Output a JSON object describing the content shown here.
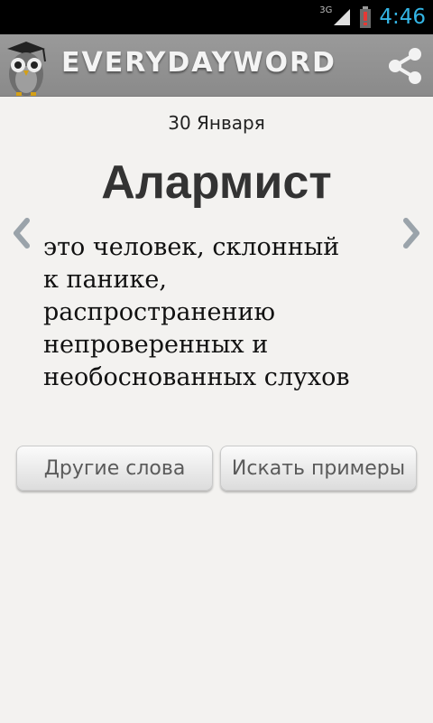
{
  "status_bar": {
    "network": "3G",
    "time": "4:46"
  },
  "app_bar": {
    "title": "EVERYDAYWORD",
    "logo_icon": "owl-logo-icon",
    "share_icon": "share-icon"
  },
  "content": {
    "date": "30 Января",
    "word": "Алармист",
    "definition": "это человек, склонный\nк панике,\nраспространению\nнепроверенных и\nнеобоснованных слухов"
  },
  "buttons": {
    "other_words": "Другие слова",
    "search_examples": "Искать примеры"
  },
  "colors": {
    "clock": "#33b5e5",
    "action_bar": "#8f8f8f",
    "background": "#f3f2f0"
  }
}
